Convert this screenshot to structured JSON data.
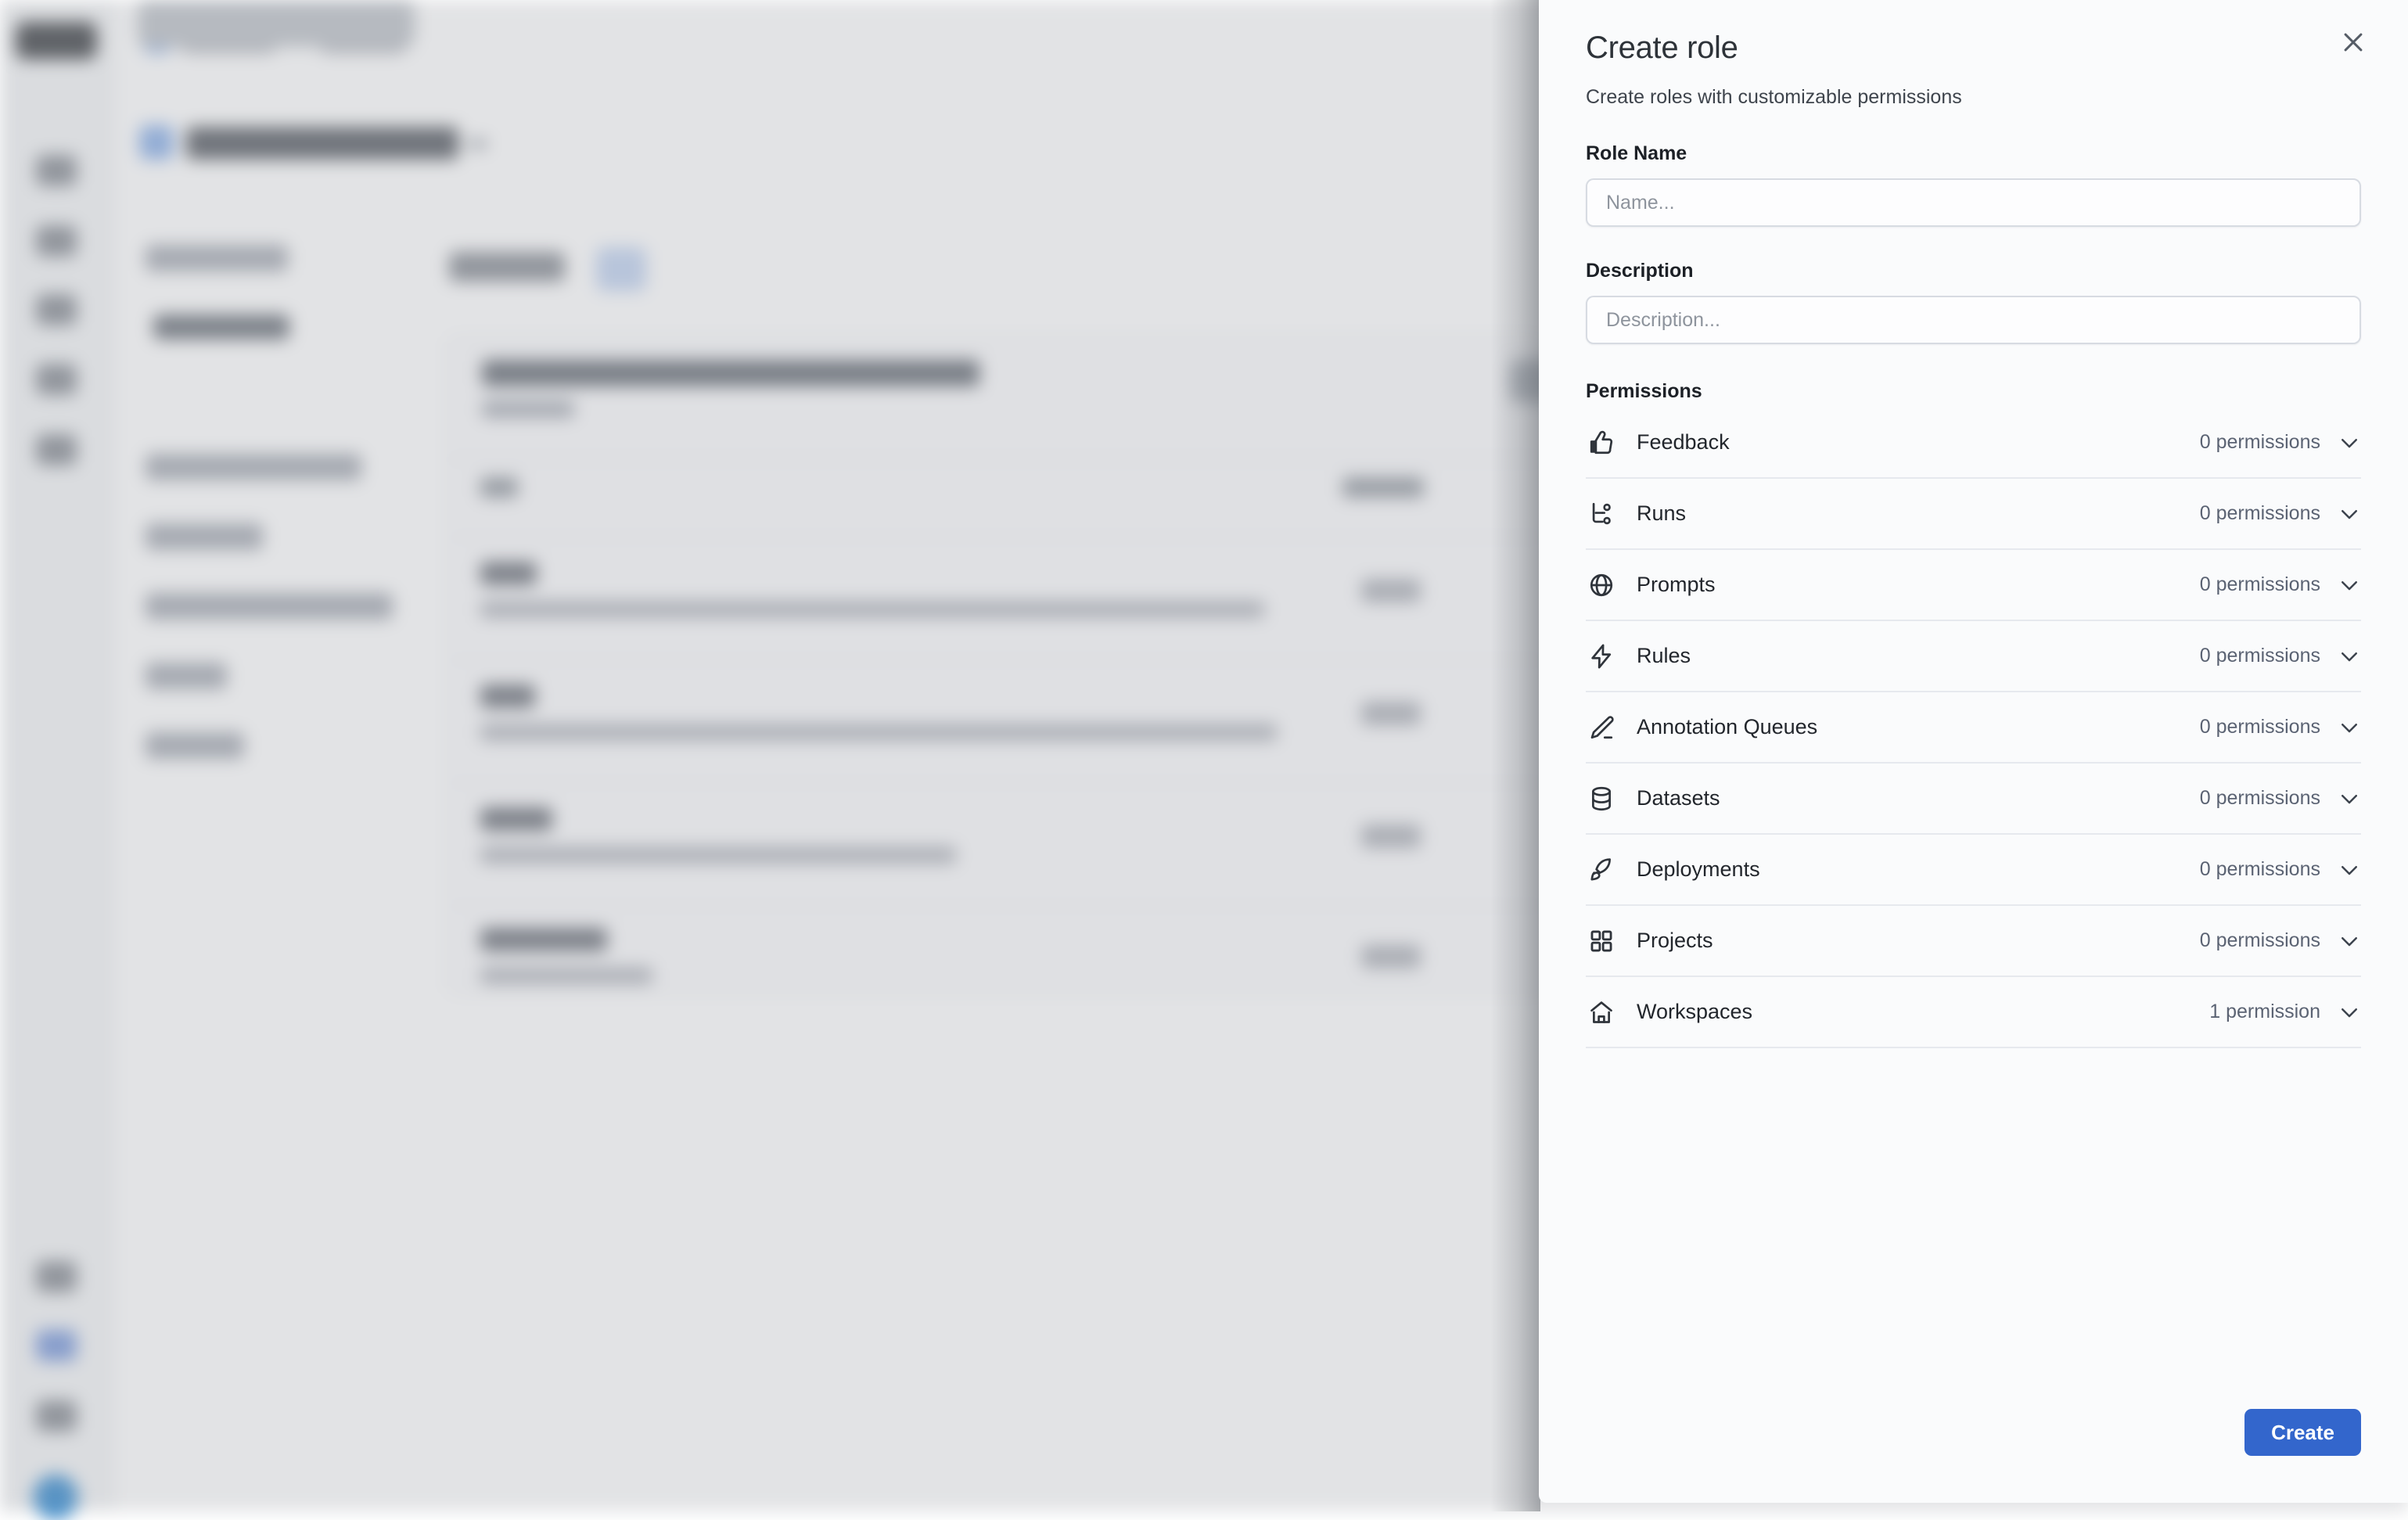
{
  "panel": {
    "title": "Create role",
    "subtitle": "Create roles with customizable permissions",
    "close_icon": "close-icon",
    "accent_color": "#3366cc",
    "background_color": "#fafbfc",
    "fields": {
      "role_name": {
        "label": "Role Name",
        "placeholder": "Name...",
        "value": ""
      },
      "description": {
        "label": "Description",
        "placeholder": "Description...",
        "value": ""
      }
    },
    "permissions_label": "Permissions",
    "permissions": [
      {
        "label": "Feedback",
        "count": "0 permissions",
        "icon": "thumbs-up-icon",
        "chevron": "chevron-down-icon"
      },
      {
        "label": "Runs",
        "count": "0 permissions",
        "icon": "git-branch-icon",
        "chevron": "chevron-down-icon"
      },
      {
        "label": "Prompts",
        "count": "0 permissions",
        "icon": "globe-icon",
        "chevron": "chevron-down-icon"
      },
      {
        "label": "Rules",
        "count": "0 permissions",
        "icon": "lightning-icon",
        "chevron": "chevron-down-icon"
      },
      {
        "label": "Annotation Queues",
        "count": "0 permissions",
        "icon": "pencil-icon",
        "chevron": "chevron-down-icon"
      },
      {
        "label": "Datasets",
        "count": "0 permissions",
        "icon": "database-icon",
        "chevron": "chevron-down-icon"
      },
      {
        "label": "Deployments",
        "count": "0 permissions",
        "icon": "rocket-icon",
        "chevron": "chevron-down-icon"
      },
      {
        "label": "Projects",
        "count": "0 permissions",
        "icon": "grid-icon",
        "chevron": "chevron-down-icon"
      },
      {
        "label": "Workspaces",
        "count": "1 permission",
        "icon": "home-icon",
        "chevron": "chevron-down-icon"
      }
    ],
    "create_label": "Create"
  },
  "background": {
    "note": "Application behind the slide-over is blurred; no text is legible.",
    "overlay_color": "#c9cbcf"
  }
}
